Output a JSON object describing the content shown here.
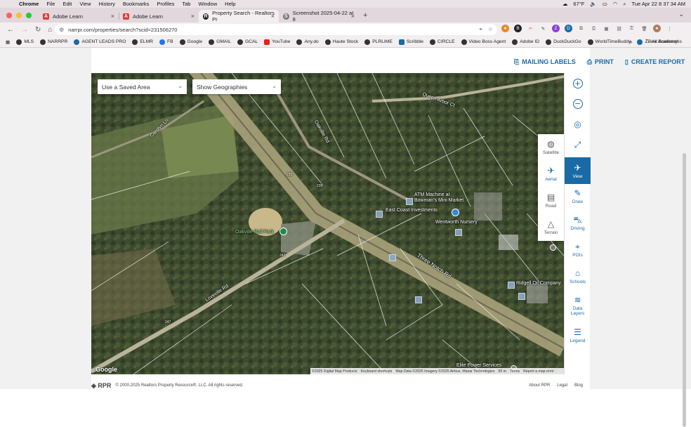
{
  "menubar": {
    "app": "Chrome",
    "menus": [
      "File",
      "Edit",
      "View",
      "History",
      "Bookmarks",
      "Profiles",
      "Tab",
      "Window",
      "Help"
    ],
    "weather": "67°F",
    "datetime": "Tue Apr 22  8 37 34 AM"
  },
  "tabs": [
    {
      "title": "Adobe Learn",
      "fav_color": "#e03c31",
      "fav_glyph": "A",
      "active": false
    },
    {
      "title": "Adobe Learn",
      "fav_color": "#e03c31",
      "fav_glyph": "A",
      "active": false
    },
    {
      "title": "Property Search - Realtors Pr",
      "fav_color": "#222222",
      "fav_glyph": "R",
      "active": true
    },
    {
      "title": "Screenshot 2025-04-22 at 8",
      "fav_color": "#666666",
      "fav_glyph": "S",
      "active": false
    }
  ],
  "omnibox": {
    "url": "narrpr.com/properties/search?scid=231506270"
  },
  "bookmarks": [
    "MLS",
    "NARRPR",
    "AGENT LEADS PRO",
    "ELMR",
    "FB",
    "Google",
    "GMAIL",
    "GCAL",
    "YouTube",
    "Any.do",
    "Haute Stock",
    "PLRLIME",
    "Scribble",
    "CIRCLE",
    "Video Boss Agent",
    "Adobe ID",
    "DuckDuckGo",
    "WorldTimeBuddy",
    "Zillow Academy"
  ],
  "bookmarks_more": "»",
  "bookmarks_all": "All Bookmarks",
  "actions": {
    "mailing": "MAILING LABELS",
    "print": "PRINT",
    "report": "CREATE REPORT"
  },
  "filters": {
    "saved_area": "Use a Saved Area",
    "geographies": "Show Geographies"
  },
  "map_labels": {
    "atm": "ATM Machine at",
    "atm2": "Bowman's Mini Market",
    "east_coast": "East Coast Investments",
    "wentworth": "Wentworth Nursery",
    "ballpark": "Oakville Ball Park",
    "three_notch": "Three Notch Rd",
    "loveville": "Loveville Rd",
    "queen_arbor": "Queen Arbor Ct",
    "oakville_rd": "Oakville Rd",
    "carolyn": "Carolyn Ln",
    "elite": "Elite Power Services",
    "oil": "Ridgell Oil Company",
    "shield1": "235",
    "shield2": "235",
    "shield3": "247",
    "shield4": "247",
    "google": "Google"
  },
  "attribution": [
    "©2025 Digital Map Products",
    "Keyboard shortcuts",
    "Map Data ©2025 Imagery ©2025 Airbus, Maxar Technologies",
    "50 m",
    "Terms",
    "Report a map error"
  ],
  "map_types": [
    {
      "label": "Satellite",
      "icon": "◍"
    },
    {
      "label": "Aerial",
      "icon": "✈"
    },
    {
      "label": "Road",
      "icon": "▤"
    },
    {
      "label": "Terrain",
      "icon": "△"
    }
  ],
  "right_tools": {
    "zoom_in": "+",
    "zoom_out": "−",
    "locate": "◎",
    "expand": "⤢",
    "view": "View",
    "draw": "Draw",
    "driving": "Driving",
    "pois": "POIs",
    "schools": "Schools",
    "data_layers_1": "Data",
    "data_layers_2": "Layers",
    "legend": "Legend"
  },
  "footer": {
    "copyright": "© 2000-2025 Realtors Property Resource®, LLC. All rights reserved.",
    "about": "About RPR",
    "legal": "Legal",
    "blog": "Blog"
  }
}
